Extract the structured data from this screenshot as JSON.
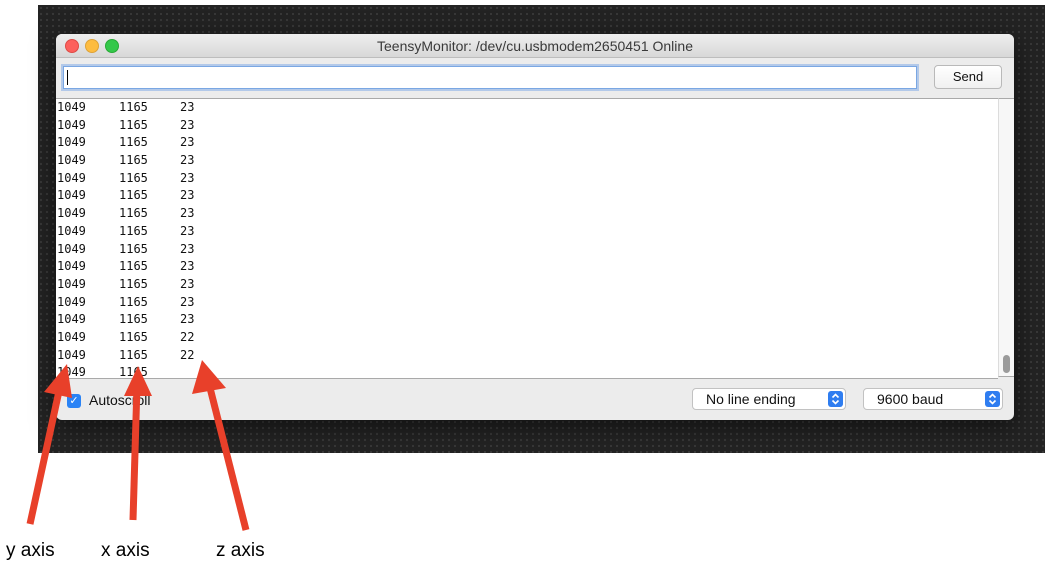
{
  "window": {
    "title": "TeensyMonitor: /dev/cu.usbmodem2650451 Online"
  },
  "toolbar": {
    "input_value": "",
    "send_label": "Send"
  },
  "output": {
    "rows": [
      [
        "1049",
        "1165",
        "23"
      ],
      [
        "1049",
        "1165",
        "23"
      ],
      [
        "1049",
        "1165",
        "23"
      ],
      [
        "1049",
        "1165",
        "23"
      ],
      [
        "1049",
        "1165",
        "23"
      ],
      [
        "1049",
        "1165",
        "23"
      ],
      [
        "1049",
        "1165",
        "23"
      ],
      [
        "1049",
        "1165",
        "23"
      ],
      [
        "1049",
        "1165",
        "23"
      ],
      [
        "1049",
        "1165",
        "23"
      ],
      [
        "1049",
        "1165",
        "23"
      ],
      [
        "1049",
        "1165",
        "23"
      ],
      [
        "1049",
        "1165",
        "23"
      ],
      [
        "1049",
        "1165",
        "22"
      ],
      [
        "1049",
        "1165",
        "22"
      ],
      [
        "1049",
        "1165",
        ""
      ]
    ]
  },
  "footer": {
    "autoscroll_label": "Autoscroll",
    "autoscroll_checked": true,
    "line_ending_value": "No line ending",
    "baud_value": "9600 baud"
  },
  "annotations": {
    "y_label": "y axis",
    "x_label": "x axis",
    "z_label": "z axis",
    "arrow_color": "#e8402a"
  }
}
